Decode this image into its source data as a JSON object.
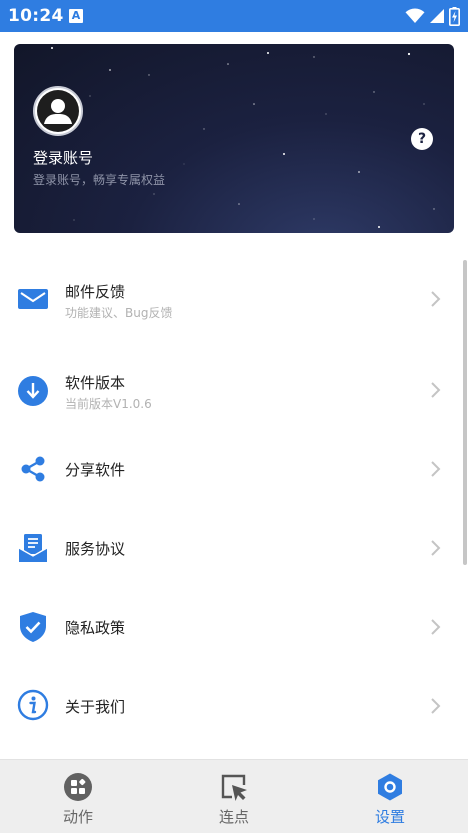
{
  "status_bar": {
    "time": "10:24",
    "notification_glyph": "A",
    "icons": [
      "wifi-icon",
      "signal-icon",
      "battery-charging-icon"
    ]
  },
  "account": {
    "title": "登录账号",
    "subtitle": "登录账号，畅享专属权益",
    "help_glyph": "?"
  },
  "menu": {
    "items": [
      {
        "id": "feedback",
        "icon": "mail-icon",
        "title": "邮件反馈",
        "subtitle": "功能建议、Bug反馈"
      },
      {
        "id": "version",
        "icon": "download-circle-icon",
        "title": "软件版本",
        "subtitle": "当前版本V1.0.6"
      },
      {
        "id": "share",
        "icon": "share-icon",
        "title": "分享软件",
        "subtitle": ""
      },
      {
        "id": "service",
        "icon": "agreement-icon",
        "title": "服务协议",
        "subtitle": ""
      },
      {
        "id": "privacy",
        "icon": "shield-check-icon",
        "title": "隐私政策",
        "subtitle": ""
      },
      {
        "id": "about",
        "icon": "info-icon",
        "title": "关于我们",
        "subtitle": ""
      }
    ]
  },
  "bottom_nav": {
    "items": [
      {
        "id": "actions",
        "icon": "actions-icon",
        "label": "动作",
        "active": false
      },
      {
        "id": "clicks",
        "icon": "click-point-icon",
        "label": "连点",
        "active": false
      },
      {
        "id": "settings",
        "icon": "settings-hex-icon",
        "label": "设置",
        "active": true
      }
    ]
  },
  "colors": {
    "accent": "#2f7de1",
    "card_dark": "#1b2140",
    "text_primary": "#222222",
    "text_secondary": "#b2b2b2",
    "nav_background": "#eeeeee"
  }
}
